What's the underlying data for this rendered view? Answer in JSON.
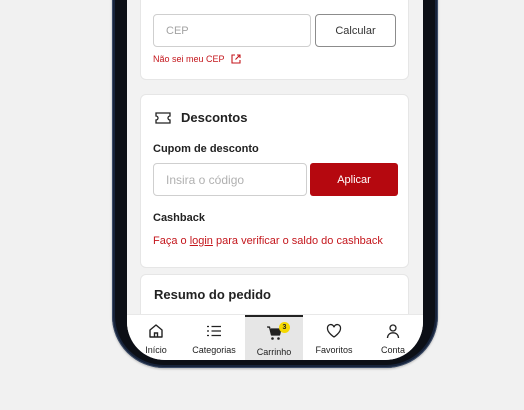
{
  "shipping": {
    "cep_placeholder": "CEP",
    "calcular_label": "Calcular",
    "nao_sei_cep_label": "Não sei meu CEP"
  },
  "descontos": {
    "title": "Descontos",
    "cupom_label": "Cupom de desconto",
    "cupom_placeholder": "Insira o código",
    "aplicar_label": "Aplicar",
    "cashback_label": "Cashback",
    "cashback_prefix": "Faça o ",
    "cashback_login": "login",
    "cashback_suffix": " para verificar o saldo do cashback"
  },
  "resumo": {
    "title": "Resumo do pedido"
  },
  "nav": {
    "items": [
      {
        "label": "Início",
        "icon": "home-icon"
      },
      {
        "label": "Categorias",
        "icon": "list-icon"
      },
      {
        "label": "Carrinho",
        "icon": "cart-icon",
        "badge": "3",
        "active": true
      },
      {
        "label": "Favoritos",
        "icon": "heart-icon"
      },
      {
        "label": "Conta",
        "icon": "user-icon"
      }
    ]
  },
  "colors": {
    "accent": "#b5080f",
    "link": "#c4161c",
    "badge": "#f5d800"
  }
}
